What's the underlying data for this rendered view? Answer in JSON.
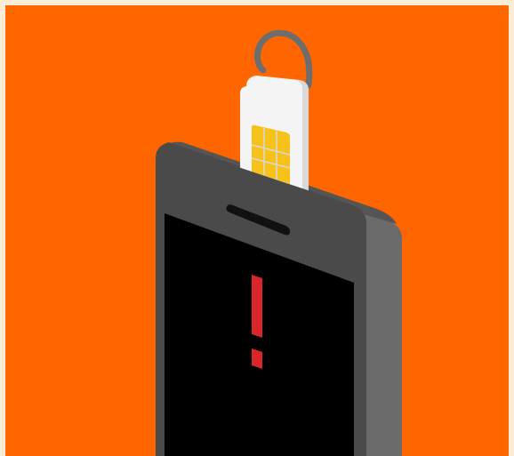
{
  "illustration": {
    "subject": "sim-card-being-removed-from-phone",
    "colors": {
      "border": "#fbecd6",
      "background": "#ff6600",
      "phone_side": "#6b6b6b",
      "phone_edge": "#555555",
      "phone_face": "#4a4a4a",
      "screen": "#000000",
      "speaker": "#111111",
      "sim_card": "#f4f4f4",
      "sim_shadow": "#d9d9d9",
      "sim_chip": "#f6c21a",
      "pull_loop": "#6d6d6d",
      "alert": "#d9262b"
    },
    "icons": [
      "exclamation-icon",
      "sim-card-icon",
      "pull-tab-icon",
      "phone-speaker-icon"
    ]
  }
}
